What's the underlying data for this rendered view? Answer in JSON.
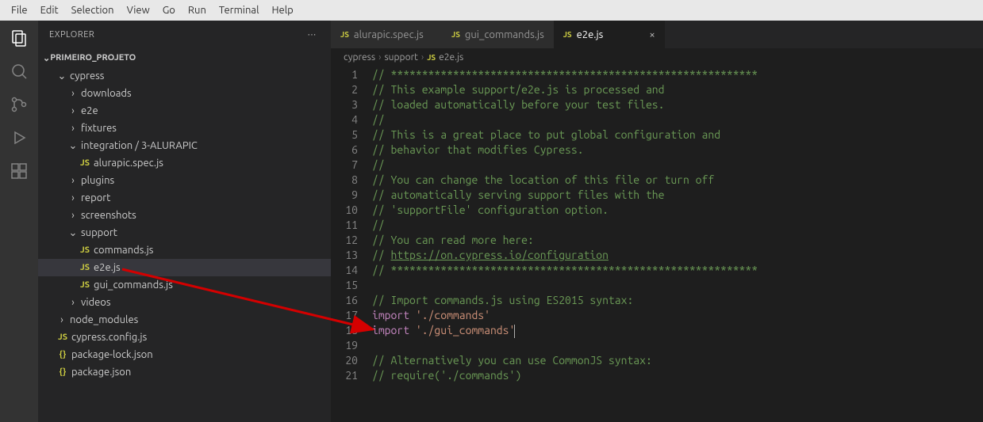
{
  "menu": {
    "items": [
      "File",
      "Edit",
      "Selection",
      "View",
      "Go",
      "Run",
      "Terminal",
      "Help"
    ]
  },
  "activitybar": {
    "explorer": "explorer",
    "search": "search",
    "scm": "source-control",
    "debug": "run-debug",
    "ext": "extensions"
  },
  "sidebar": {
    "title": "EXPLORER",
    "project": "PRIMEIRO_PROJETO",
    "tree": [
      {
        "depth": 1,
        "kind": "folder",
        "open": true,
        "label": "cypress"
      },
      {
        "depth": 2,
        "kind": "folder",
        "open": false,
        "label": "downloads"
      },
      {
        "depth": 2,
        "kind": "folder",
        "open": false,
        "label": "e2e"
      },
      {
        "depth": 2,
        "kind": "folder",
        "open": false,
        "label": "fixtures"
      },
      {
        "depth": 2,
        "kind": "folder",
        "open": true,
        "label": "integration / 3-ALURAPIC"
      },
      {
        "depth": 3,
        "kind": "js",
        "label": "alurapic.spec.js"
      },
      {
        "depth": 2,
        "kind": "folder",
        "open": false,
        "label": "plugins"
      },
      {
        "depth": 2,
        "kind": "folder",
        "open": false,
        "label": "report"
      },
      {
        "depth": 2,
        "kind": "folder",
        "open": false,
        "label": "screenshots"
      },
      {
        "depth": 2,
        "kind": "folder",
        "open": true,
        "label": "support"
      },
      {
        "depth": 3,
        "kind": "js",
        "label": "commands.js"
      },
      {
        "depth": 3,
        "kind": "js",
        "label": "e2e.js",
        "active": true
      },
      {
        "depth": 3,
        "kind": "js",
        "label": "gui_commands.js"
      },
      {
        "depth": 2,
        "kind": "folder",
        "open": false,
        "label": "videos"
      },
      {
        "depth": 1,
        "kind": "folder",
        "open": false,
        "label": "node_modules"
      },
      {
        "depth": 1,
        "kind": "js",
        "label": "cypress.config.js"
      },
      {
        "depth": 1,
        "kind": "json",
        "label": "package-lock.json"
      },
      {
        "depth": 1,
        "kind": "json",
        "label": "package.json"
      }
    ]
  },
  "tabs": [
    {
      "label": "alurapic.spec.js",
      "icon": "js",
      "active": false
    },
    {
      "label": "gui_commands.js",
      "icon": "js",
      "active": false
    },
    {
      "label": "e2e.js",
      "icon": "js",
      "active": true
    }
  ],
  "breadcrumb": {
    "p0": "cypress",
    "p1": "support",
    "p2": "e2e.js",
    "icon": "js"
  },
  "code": {
    "lines": [
      {
        "n": 1,
        "t": "comment",
        "text": "// ***********************************************************"
      },
      {
        "n": 2,
        "t": "comment",
        "text": "// This example support/e2e.js is processed and"
      },
      {
        "n": 3,
        "t": "comment",
        "text": "// loaded automatically before your test files."
      },
      {
        "n": 4,
        "t": "comment",
        "text": "//"
      },
      {
        "n": 5,
        "t": "comment",
        "text": "// This is a great place to put global configuration and"
      },
      {
        "n": 6,
        "t": "comment",
        "text": "// behavior that modifies Cypress."
      },
      {
        "n": 7,
        "t": "comment",
        "text": "//"
      },
      {
        "n": 8,
        "t": "comment",
        "text": "// You can change the location of this file or turn off"
      },
      {
        "n": 9,
        "t": "comment",
        "text": "// automatically serving support files with the"
      },
      {
        "n": 10,
        "t": "comment",
        "text": "// 'supportFile' configuration option."
      },
      {
        "n": 11,
        "t": "comment",
        "text": "//"
      },
      {
        "n": 12,
        "t": "commentlink",
        "pre": "// You can read more here:",
        "text": ""
      },
      {
        "n": 13,
        "t": "link",
        "pre": "// ",
        "link": "https://on.cypress.io/configuration"
      },
      {
        "n": 14,
        "t": "comment",
        "text": "// ***********************************************************"
      },
      {
        "n": 15,
        "t": "blank",
        "text": ""
      },
      {
        "n": 16,
        "t": "comment",
        "text": "// Import commands.js using ES2015 syntax:"
      },
      {
        "n": 17,
        "t": "import",
        "kw": "import",
        "str": "'./commands'"
      },
      {
        "n": 18,
        "t": "importcur",
        "kw": "import",
        "str": "'./gui_commands'"
      },
      {
        "n": 19,
        "t": "blank",
        "text": ""
      },
      {
        "n": 20,
        "t": "comment",
        "text": "// Alternatively you can use CommonJS syntax:"
      },
      {
        "n": 21,
        "t": "comment",
        "text": "// require('./commands')"
      }
    ]
  }
}
